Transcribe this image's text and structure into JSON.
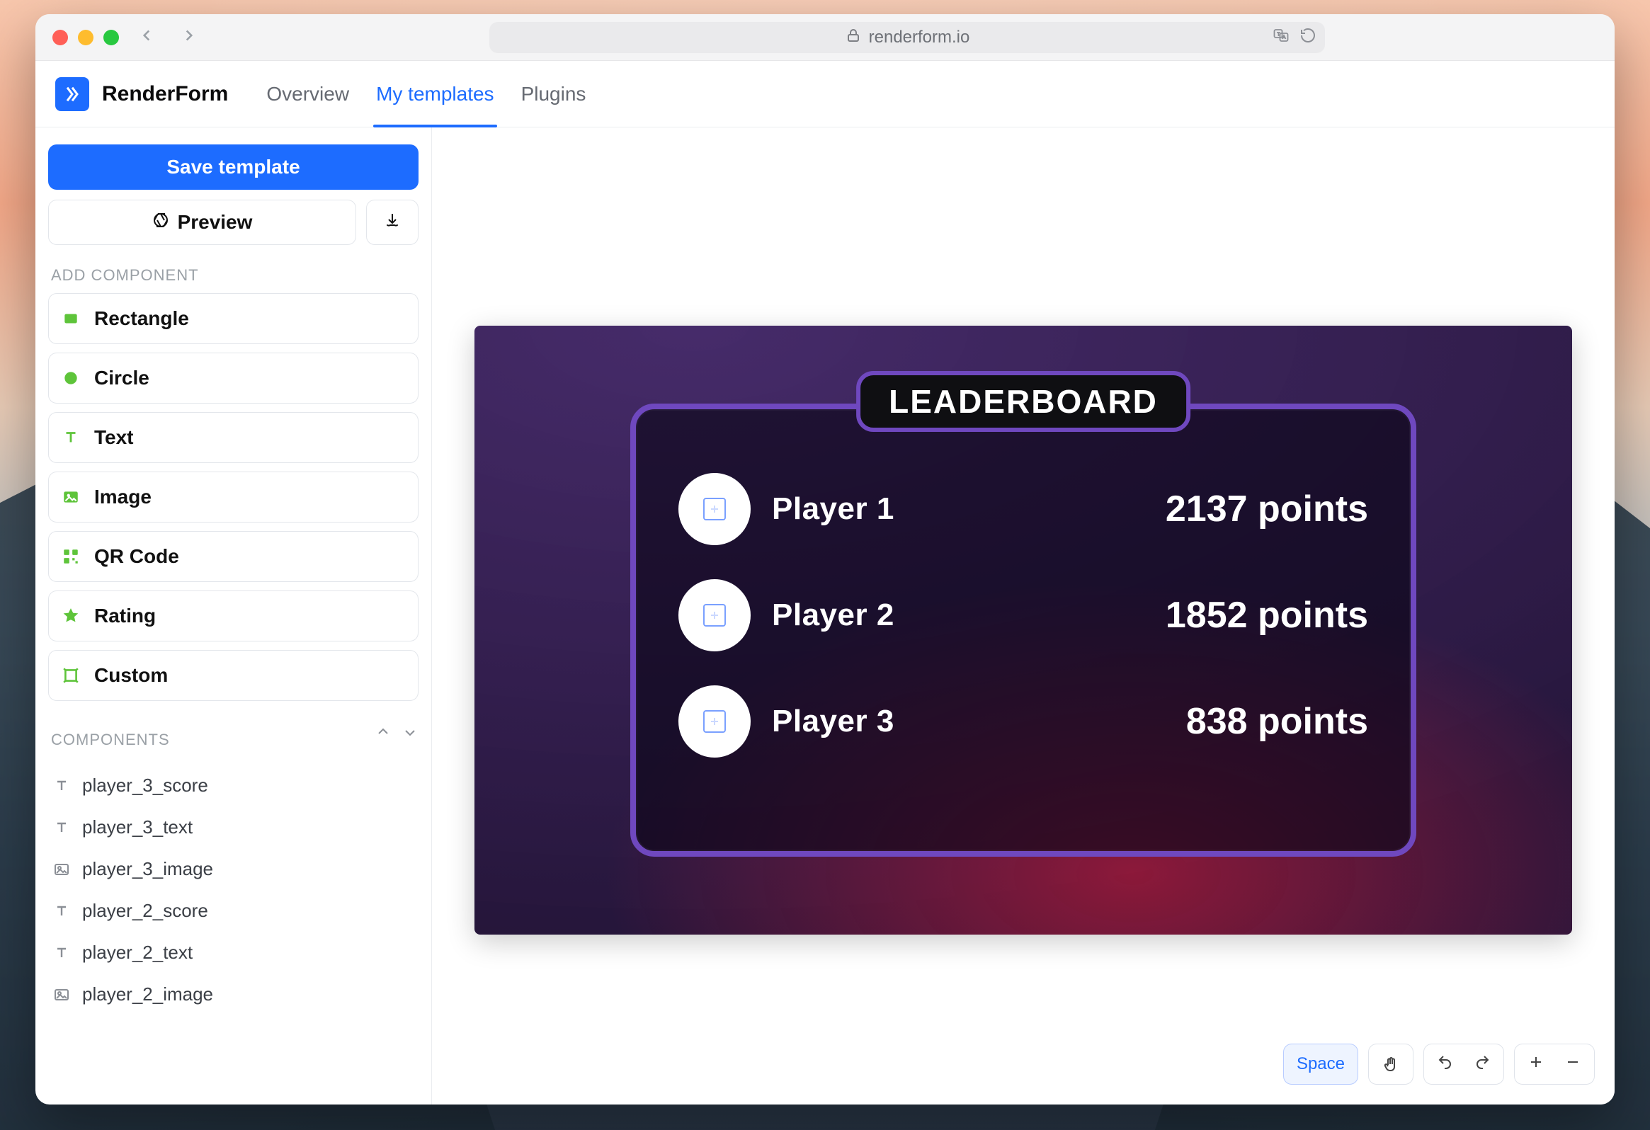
{
  "browser": {
    "url": "renderform.io"
  },
  "app": {
    "name": "RenderForm",
    "tabs": [
      {
        "id": "overview",
        "label": "Overview",
        "active": false
      },
      {
        "id": "my-templates",
        "label": "My templates",
        "active": true
      },
      {
        "id": "plugins",
        "label": "Plugins",
        "active": false
      }
    ]
  },
  "sidebar": {
    "save_label": "Save template",
    "preview_label": "Preview",
    "download_aria": "Download",
    "add_component_title": "ADD COMPONENT",
    "add_components": [
      {
        "icon": "rectangle-icon",
        "label": "Rectangle"
      },
      {
        "icon": "circle-icon",
        "label": "Circle"
      },
      {
        "icon": "text-icon",
        "label": "Text"
      },
      {
        "icon": "image-icon",
        "label": "Image"
      },
      {
        "icon": "qrcode-icon",
        "label": "QR Code"
      },
      {
        "icon": "rating-icon",
        "label": "Rating"
      },
      {
        "icon": "custom-icon",
        "label": "Custom"
      }
    ],
    "components_title": "COMPONENTS",
    "layers": [
      {
        "type": "text",
        "name": "player_3_score"
      },
      {
        "type": "text",
        "name": "player_3_text"
      },
      {
        "type": "image",
        "name": "player_3_image"
      },
      {
        "type": "text",
        "name": "player_2_score"
      },
      {
        "type": "text",
        "name": "player_2_text"
      },
      {
        "type": "image",
        "name": "player_2_image"
      }
    ]
  },
  "canvas": {
    "space_label": "Space",
    "leaderboard_title": "LEADERBOARD",
    "players": [
      {
        "name": "Player 1",
        "score": "2137 points"
      },
      {
        "name": "Player 2",
        "score": "1852 points"
      },
      {
        "name": "Player 3",
        "score": "838 points"
      }
    ]
  },
  "colors": {
    "accent": "#1d6cff",
    "board_border": "#6f48bf"
  }
}
